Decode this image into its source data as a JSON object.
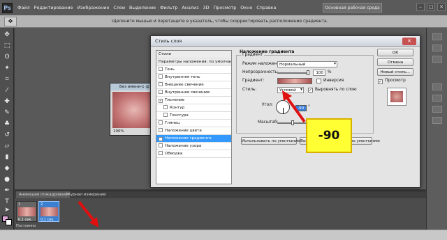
{
  "menubar": {
    "logo": "Ps",
    "items": [
      "Файл",
      "Редактирование",
      "Изображение",
      "Слои",
      "Выделение",
      "Фильтр",
      "Анализ",
      "3D",
      "Просмотр",
      "Окно",
      "Справка"
    ],
    "workspace": "Основная рабочая среда",
    "window_controls": [
      "–",
      "□",
      "✕"
    ]
  },
  "optionsbar": {
    "hint": "Щелкните мышью и перетащите в указатель, чтобы скорректировать расположение градиента."
  },
  "document": {
    "title": "Без имени-1 @ 100%",
    "zoom": "100%"
  },
  "dialog": {
    "title": "Стиль слоя",
    "close": "✕",
    "styles": [
      {
        "label": "Стили",
        "kind": "header"
      },
      {
        "label": "Параметры наложения: по умолчанию",
        "kind": "header"
      },
      {
        "label": "Тень",
        "checked": false
      },
      {
        "label": "Внутренняя тень",
        "checked": false
      },
      {
        "label": "Внешнее свечение",
        "checked": false
      },
      {
        "label": "Внутреннее свечение",
        "checked": false
      },
      {
        "label": "Тиснение",
        "checked": true
      },
      {
        "label": "Контур",
        "checked": false,
        "indent": true
      },
      {
        "label": "Текстура",
        "checked": false,
        "indent": true
      },
      {
        "label": "Глянец",
        "checked": false
      },
      {
        "label": "Наложение цвета",
        "checked": false
      },
      {
        "label": "Наложение градиента",
        "checked": true,
        "selected": true
      },
      {
        "label": "Наложение узора",
        "checked": false
      },
      {
        "label": "Обводка",
        "checked": false
      }
    ],
    "section_title": "Наложение градиента",
    "group_label": "Градиент",
    "blend_mode_label": "Режим наложения:",
    "blend_mode_value": "Нормальный",
    "opacity_label": "Непрозрачность:",
    "opacity_value": "100",
    "opacity_unit": "%",
    "gradient_label": "Градиент:",
    "reverse_label": "Инверсия",
    "style_label": "Стиль:",
    "style_value": "Угловой",
    "align_label": "Выровнять по слою",
    "angle_label": "Угол:",
    "angle_value": "-90",
    "angle_unit": "°",
    "scale_label": "Масштаб:",
    "scale_value": "100",
    "scale_unit": "%",
    "default_btn": "Использовать по умолчанию",
    "reset_btn": "Восстановить значения по умолчанию",
    "ok": "ОК",
    "cancel": "Отмена",
    "new_style": "Новый стиль...",
    "preview": "Просмотр"
  },
  "annotation": "-90",
  "animation": {
    "tab1": "Анимация (покадровая)",
    "tab2": "Журнал измерений",
    "frames": [
      {
        "num": "1",
        "time": "0,1 сек."
      },
      {
        "num": "2",
        "time": "0,1 сек."
      }
    ],
    "loop": "Постоянно"
  },
  "colors": {
    "accent": "#3399ff",
    "annotation_bg": "#ffff33",
    "arrow": "#e01010"
  }
}
